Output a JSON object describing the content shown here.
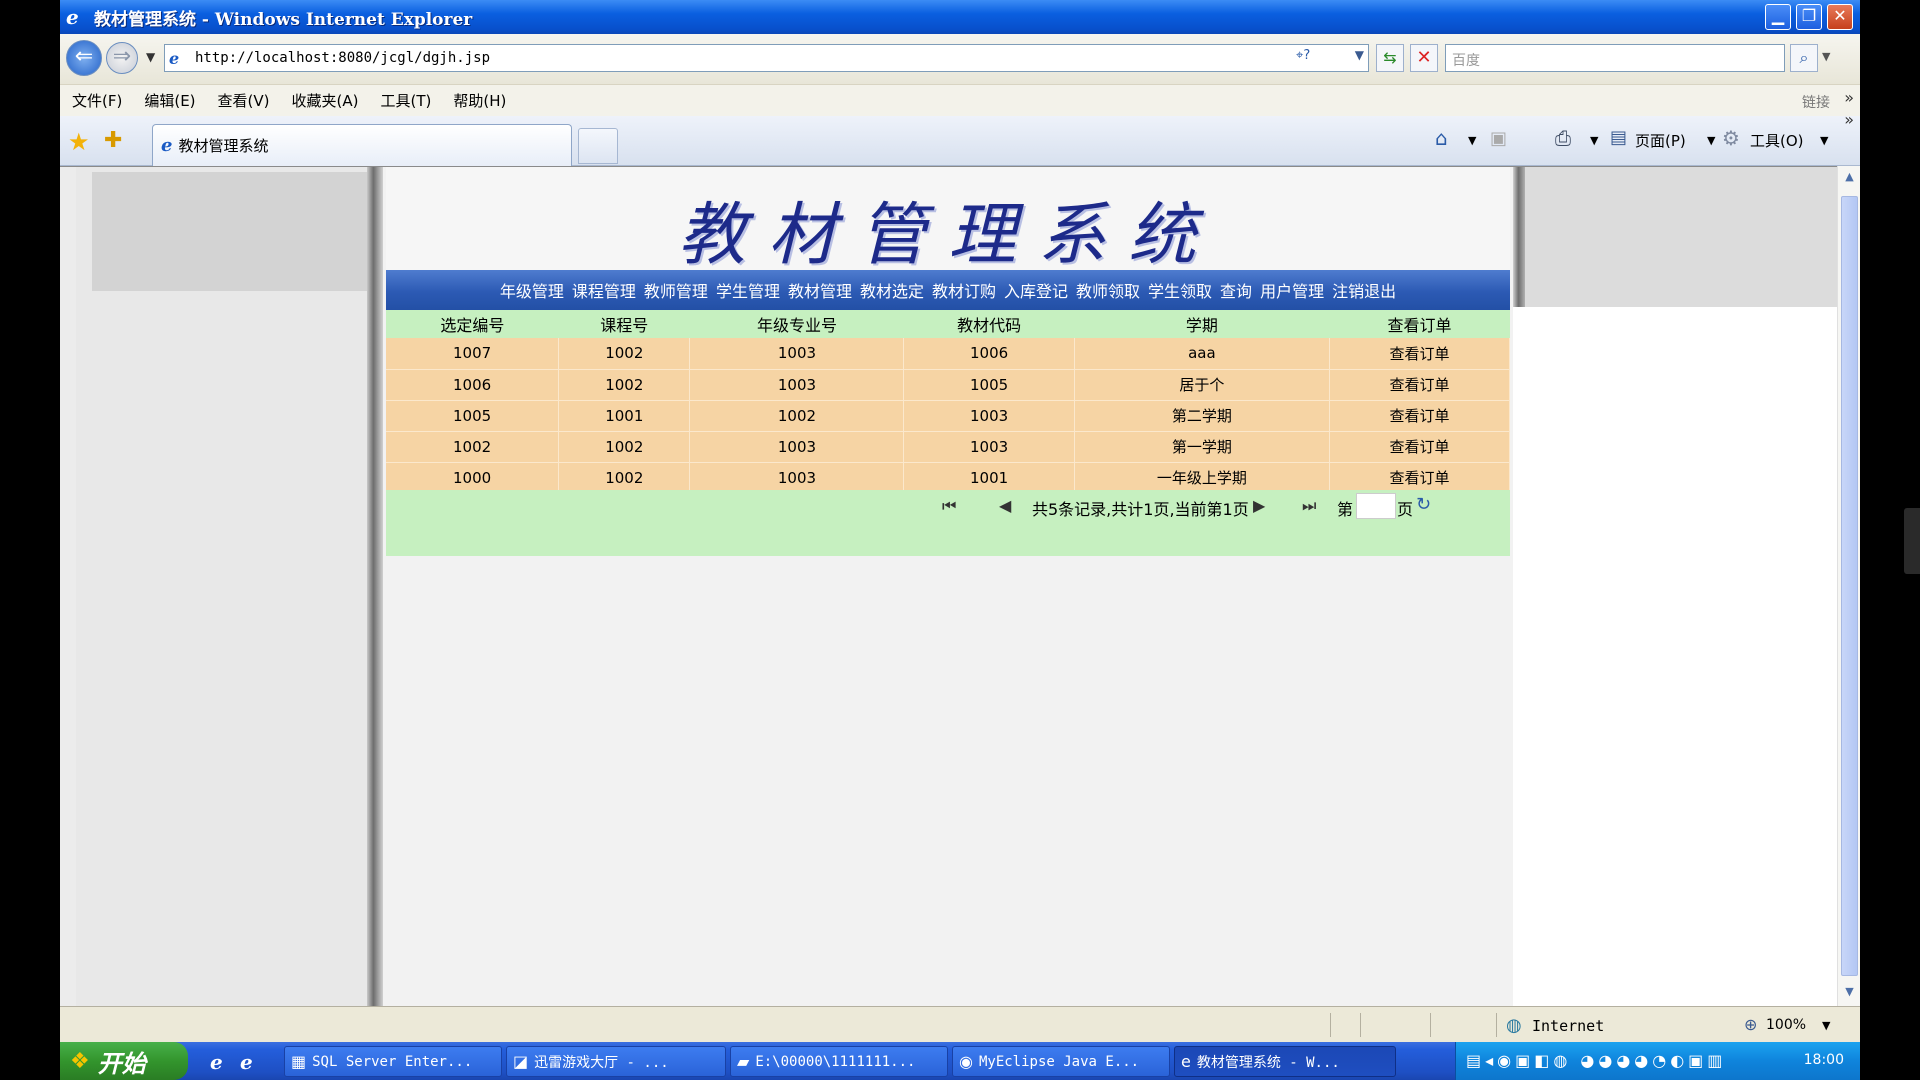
{
  "window": {
    "title": "教材管理系统 - Windows Internet Explorer",
    "min_glyph": "▁",
    "max_glyph": "❐",
    "close_glyph": "✕"
  },
  "address": {
    "url": "http://localhost:8080/jcgl/dgjh.jsp",
    "search_placeholder": "百度"
  },
  "menubar": {
    "items": [
      "文件(F)",
      "编辑(E)",
      "查看(V)",
      "收藏夹(A)",
      "工具(T)",
      "帮助(H)"
    ],
    "links_label": "链接"
  },
  "tabs": {
    "active_title": "教材管理系统"
  },
  "toolbar": {
    "page_label": "页面(P)",
    "tools_label": "工具(O)"
  },
  "page": {
    "system_title": "教材管理系统",
    "nav_links": [
      "年级管理",
      "课程管理",
      "教师管理",
      "学生管理",
      "教材管理",
      "教材选定",
      "教材订购",
      "入库登记",
      "教师领取",
      "学生领取",
      "查询",
      "用户管理",
      "注销退出"
    ],
    "table": {
      "columns": [
        "选定编号",
        "课程号",
        "年级专业号",
        "教材代码",
        "学期",
        "查看订单"
      ],
      "rows": [
        [
          "1007",
          "1002",
          "1003",
          "1006",
          "aaa",
          "查看订单"
        ],
        [
          "1006",
          "1002",
          "1003",
          "1005",
          "居于个",
          "查看订单"
        ],
        [
          "1005",
          "1001",
          "1002",
          "1003",
          "第二学期",
          "查看订单"
        ],
        [
          "1002",
          "1002",
          "1003",
          "1003",
          "第一学期",
          "查看订单"
        ],
        [
          "1000",
          "1002",
          "1003",
          "1001",
          "一年级上学期",
          "查看订单"
        ]
      ]
    },
    "pager": {
      "info": "共5条记录,共计1页,当前第1页",
      "goto_prefix": "第",
      "goto_suffix": "页"
    }
  },
  "statusbar": {
    "zone": "Internet",
    "zoom": "100%"
  },
  "taskbar": {
    "start_label": "开始",
    "tasks": [
      "SQL Server Enter...",
      "迅雷游戏大厅 - ...",
      "E:\\00000\\1111111...",
      "MyEclipse Java E...",
      "教材管理系统 - W..."
    ],
    "clock": "18:00"
  }
}
